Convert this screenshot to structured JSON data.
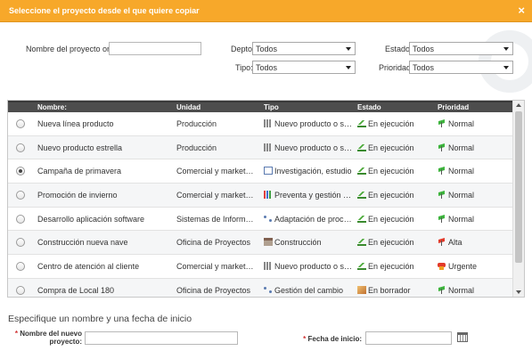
{
  "dialog": {
    "title": "Seleccione el proyecto desde el que quiere copiar",
    "close_label": "×"
  },
  "filters": {
    "nombre_label": "Nombre del proyecto original:",
    "nombre_value": "",
    "depto_label": "Depto.:",
    "depto_value": "Todos",
    "estado_label": "Estado:",
    "estado_value": "Todos",
    "tipo_label": "Tipo:",
    "tipo_value": "Todos",
    "prioridad_label": "Prioridad:",
    "prioridad_value": "Todos"
  },
  "table": {
    "columns": [
      "Nombre:",
      "Unidad",
      "Tipo",
      "Estado",
      "Prioridad"
    ],
    "rows": [
      {
        "selected": false,
        "nombre": "Nueva línea producto",
        "unidad": "Producción",
        "tipo": "Nuevo producto o servicio",
        "tipo_icon": "bar-icon",
        "estado": "En ejecución",
        "estado_icon": "chart-up-icon",
        "prioridad": "Normal",
        "prioridad_icon": "flag-green-icon"
      },
      {
        "selected": false,
        "nombre": "Nuevo producto estrella",
        "unidad": "Producción",
        "tipo": "Nuevo producto o servicio",
        "tipo_icon": "bar-icon",
        "estado": "En ejecución",
        "estado_icon": "chart-up-icon",
        "prioridad": "Normal",
        "prioridad_icon": "flag-green-icon"
      },
      {
        "selected": true,
        "nombre": "Campaña de primavera",
        "unidad": "Comercial y marketing",
        "tipo": "Investigación, estudio",
        "tipo_icon": "edit-icon",
        "estado": "En ejecución",
        "estado_icon": "chart-up-icon",
        "prioridad": "Normal",
        "prioridad_icon": "flag-green-icon"
      },
      {
        "selected": false,
        "nombre": "Promoción de invierno",
        "unidad": "Comercial y marketing",
        "tipo": "Preventa y gestión comercial",
        "tipo_icon": "chart-icon",
        "estado": "En ejecución",
        "estado_icon": "chart-up-icon",
        "prioridad": "Normal",
        "prioridad_icon": "flag-green-icon"
      },
      {
        "selected": false,
        "nombre": "Desarrollo aplicación software",
        "unidad": "Sistemas de Información",
        "tipo": "Adaptación de procesos",
        "tipo_icon": "flow-icon",
        "estado": "En ejecución",
        "estado_icon": "chart-up-icon",
        "prioridad": "Normal",
        "prioridad_icon": "flag-green-icon"
      },
      {
        "selected": false,
        "nombre": "Construcción nueva nave",
        "unidad": "Oficina de Proyectos",
        "tipo": "Construcción",
        "tipo_icon": "build-icon",
        "estado": "En ejecución",
        "estado_icon": "chart-up-icon",
        "prioridad": "Alta",
        "prioridad_icon": "flag-red-icon"
      },
      {
        "selected": false,
        "nombre": "Centro de atención al cliente",
        "unidad": "Comercial y marketing",
        "tipo": "Nuevo producto o servicio",
        "tipo_icon": "bar-icon",
        "estado": "En ejecución",
        "estado_icon": "chart-up-icon",
        "prioridad": "Urgente",
        "prioridad_icon": "urgent-icon"
      },
      {
        "selected": false,
        "nombre": "Compra de Local 180",
        "unidad": "Oficina de Proyectos",
        "tipo": "Gestión del cambio",
        "tipo_icon": "flow-icon",
        "estado": "En borrador",
        "estado_icon": "draft-icon",
        "prioridad": "Normal",
        "prioridad_icon": "flag-green-icon"
      }
    ]
  },
  "new_project": {
    "section_title": "Especifique un nombre y una fecha de inicio",
    "required_mark": "*",
    "nombre_label_1": "Nombre del nuevo",
    "nombre_label_2": "proyecto:",
    "nombre_value": "",
    "fecha_label": "Fecha de inicio:",
    "fecha_value": ""
  },
  "colors": {
    "titlebar": "#f7a82a",
    "header": "#4d4d4d",
    "required": "#d03030"
  }
}
